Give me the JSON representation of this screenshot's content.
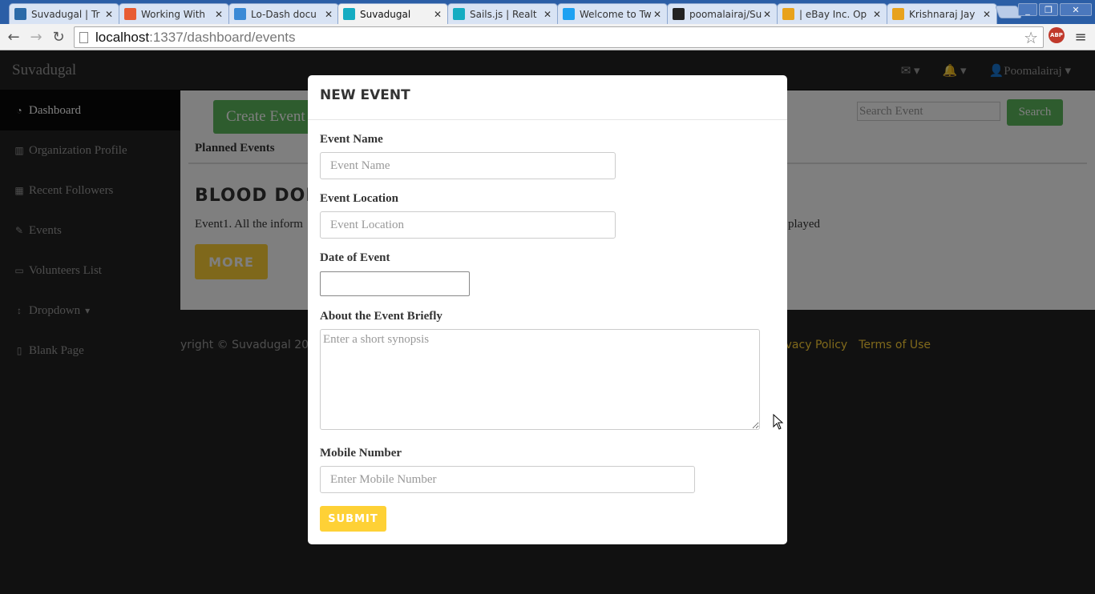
{
  "browser": {
    "tabs": [
      {
        "title": "Suvadugal | Tr",
        "favicon": "trello-icon",
        "color": "#2b6aa8"
      },
      {
        "title": "Working With",
        "favicon": "plus-icon",
        "color": "#e85c33"
      },
      {
        "title": "Lo-Dash docu",
        "favicon": "lodash-icon",
        "color": "#3a8ad6"
      },
      {
        "title": "Suvadugal",
        "favicon": "sails-icon",
        "color": "#14acc2"
      },
      {
        "title": "Sails.js | Realt",
        "favicon": "sails-icon",
        "color": "#14acc2"
      },
      {
        "title": "Welcome to Tw",
        "favicon": "twitter-icon",
        "color": "#1da1f2"
      },
      {
        "title": "poomalairaj/Su",
        "favicon": "github-icon",
        "color": "#222222"
      },
      {
        "title": "| eBay Inc. Op",
        "favicon": "pinwheel-icon",
        "color": "#e8a21c"
      },
      {
        "title": "Krishnaraj Jay",
        "favicon": "pinwheel-icon",
        "color": "#e8a21c"
      }
    ],
    "url_host": "localhost",
    "url_path": ":1337/dashboard/events",
    "abp_label": "ABP"
  },
  "app": {
    "brand": "Suvadugal",
    "nav_right": {
      "messages": "✉ ▾",
      "alerts": "🔔 ▾",
      "user": "Poomalairaj"
    },
    "sidebar": [
      {
        "label": "Dashboard",
        "icon": "dashboard-icon",
        "glyph": "◔"
      },
      {
        "label": "Organization Profile",
        "icon": "bar-chart-icon",
        "glyph": "▥"
      },
      {
        "label": "Recent Followers",
        "icon": "table-icon",
        "glyph": "▦"
      },
      {
        "label": "Events",
        "icon": "edit-icon",
        "glyph": "✎"
      },
      {
        "label": "Volunteers List",
        "icon": "desktop-icon",
        "glyph": "▭"
      },
      {
        "label": "Dropdown",
        "icon": "arrows-v-icon",
        "glyph": "↕"
      },
      {
        "label": "Blank Page",
        "icon": "file-icon",
        "glyph": "▯"
      }
    ],
    "create_button": "Create Event",
    "search_placeholder": "Search Event",
    "search_button": "Search",
    "tab_label": "Planned Events",
    "event_title": "BLOOD DON",
    "event_desc": "Event1. All the inform",
    "event_desc_end": "played",
    "more_button": "MORE",
    "footer_copy": "yright © Suvadugal 20",
    "footer_links": [
      "rivacy Policy",
      "Terms of Use"
    ]
  },
  "modal": {
    "title": "NEW EVENT",
    "fields": {
      "event_name": {
        "label": "Event Name",
        "placeholder": "Event Name"
      },
      "event_location": {
        "label": "Event Location",
        "placeholder": "Event Location"
      },
      "date": {
        "label": "Date of Event"
      },
      "about": {
        "label": "About the Event Briefly",
        "placeholder": "Enter a short synopsis"
      },
      "mobile": {
        "label": "Mobile Number",
        "placeholder": "Enter Mobile Number"
      }
    },
    "submit": "SUBMIT"
  },
  "colors": {
    "accent_yellow": "#fed136",
    "success_green": "#5cb85c",
    "navbar_dark": "#222222"
  }
}
